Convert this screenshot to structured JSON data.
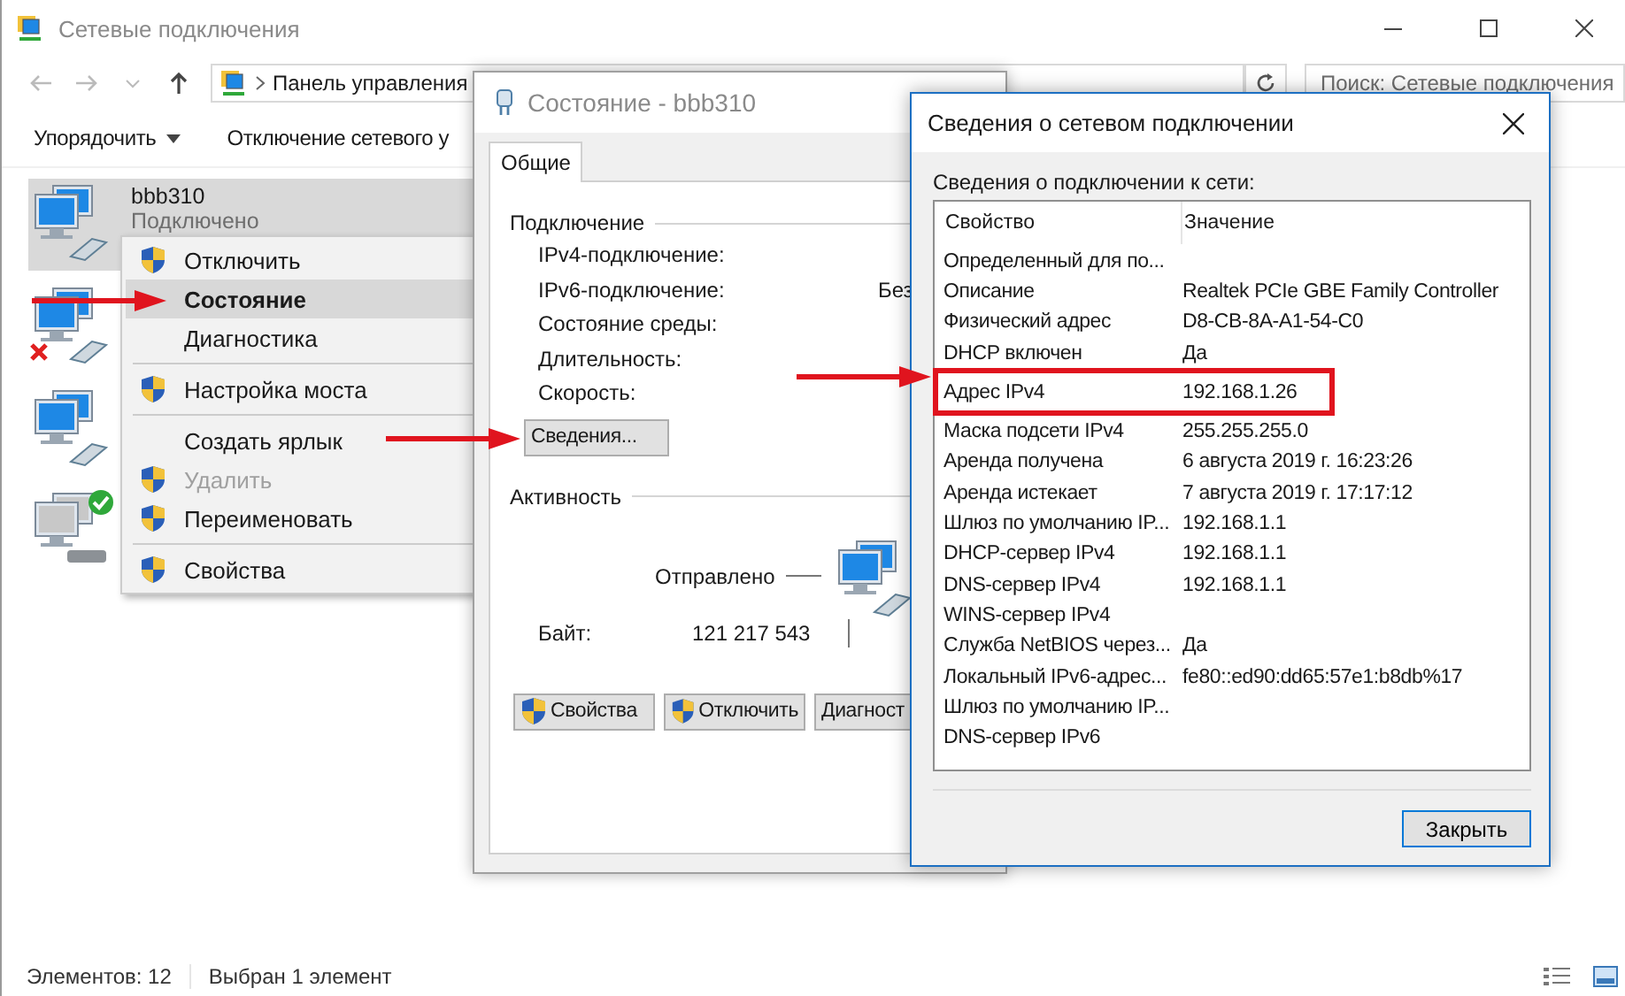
{
  "window": {
    "title": "Сетевые подключения"
  },
  "address_bar": {
    "path": "Панель управления"
  },
  "search": {
    "placeholder": "Поиск: Сетевые подключения"
  },
  "toolbar": [
    {
      "label": "Упорядочить",
      "menu": true
    },
    {
      "label": "Отключение сетевого у",
      "menu": false
    }
  ],
  "connections": [
    {
      "name": "bbb310",
      "status": "Подключено",
      "selected": true,
      "kind": "adapter",
      "error": false,
      "ok": false
    },
    {
      "selected": false,
      "kind": "adapter",
      "error": true,
      "ok": false
    },
    {
      "selected": false,
      "kind": "adapter",
      "error": false,
      "ok": false
    },
    {
      "selected": false,
      "kind": "virtual",
      "error": false,
      "ok": true
    }
  ],
  "context_menu": [
    {
      "kind": "item",
      "label": "Отключить",
      "shield": true,
      "default": false,
      "selected": false,
      "disabled": false
    },
    {
      "kind": "item",
      "label": "Состояние",
      "shield": false,
      "default": true,
      "selected": true,
      "disabled": false
    },
    {
      "kind": "item",
      "label": "Диагностика",
      "shield": false,
      "default": false,
      "selected": false,
      "disabled": false
    },
    {
      "kind": "separator"
    },
    {
      "kind": "item",
      "label": "Настройка моста",
      "shield": true,
      "default": false,
      "selected": false,
      "disabled": false
    },
    {
      "kind": "separator"
    },
    {
      "kind": "item",
      "label": "Создать ярлык",
      "shield": false,
      "default": false,
      "selected": false,
      "disabled": false
    },
    {
      "kind": "item",
      "label": "Удалить",
      "shield": true,
      "default": false,
      "selected": false,
      "disabled": true
    },
    {
      "kind": "item",
      "label": "Переименовать",
      "shield": true,
      "default": false,
      "selected": false,
      "disabled": false
    },
    {
      "kind": "separator"
    },
    {
      "kind": "item",
      "label": "Свойства",
      "shield": true,
      "default": false,
      "selected": false,
      "disabled": false
    }
  ],
  "status_dialog": {
    "title": "Состояние - bbb310",
    "tabs": [
      {
        "label": "Общие",
        "selected": true
      }
    ],
    "connection_group": "Подключение",
    "fields": [
      {
        "label": "IPv4-подключение:"
      },
      {
        "label": "IPv6-подключение:",
        "value": "Без"
      },
      {
        "label": "Состояние среды:"
      },
      {
        "label": "Длительность:"
      },
      {
        "label": "Скорость:"
      }
    ],
    "details_button": "Сведения...",
    "activity_group": "Активность",
    "sent_label": "Отправлено",
    "bytes_label": "Байт:",
    "bytes_sent": "121 217 543",
    "buttons": [
      {
        "label": "Свойства",
        "shield": true
      },
      {
        "label": "Отключить",
        "shield": true
      },
      {
        "label": "Диагност",
        "shield": false
      }
    ]
  },
  "details_dialog": {
    "title": "Сведения о сетевом подключении",
    "caption": "Сведения о подключении к сети:",
    "columns": [
      "Свойство",
      "Значение"
    ],
    "rows": [
      {
        "property": "Определенный для по...",
        "highlighted": false
      },
      {
        "property": "Описание",
        "value": "Realtek PCIe GBE Family Controller",
        "highlighted": false
      },
      {
        "property": "Физический адрес",
        "value": "D8-CB-8A-A1-54-C0",
        "highlighted": false
      },
      {
        "property": "DHCP включен",
        "value": "Да",
        "highlighted": false
      },
      {
        "property": "Адрес IPv4",
        "value": "192.168.1.26",
        "highlighted": true
      },
      {
        "property": "Маска подсети IPv4",
        "value": "255.255.255.0",
        "highlighted": false
      },
      {
        "property": "Аренда получена",
        "value": "6 августа 2019 г. 16:23:26",
        "highlighted": false
      },
      {
        "property": "Аренда истекает",
        "value": "7 августа 2019 г. 17:17:12",
        "highlighted": false
      },
      {
        "property": "Шлюз по умолчанию IP...",
        "value": "192.168.1.1",
        "highlighted": false
      },
      {
        "property": "DHCP-сервер IPv4",
        "value": "192.168.1.1",
        "highlighted": false
      },
      {
        "property": "DNS-сервер IPv4",
        "value": "192.168.1.1",
        "highlighted": false
      },
      {
        "property": "WINS-сервер IPv4",
        "highlighted": false
      },
      {
        "property": "Служба NetBIOS через...",
        "value": "Да",
        "highlighted": false
      },
      {
        "property": "Локальный IPv6-адрес...",
        "value": "fe80::ed90:dd65:57e1:b8db%17",
        "highlighted": false
      },
      {
        "property": "Шлюз по умолчанию IP...",
        "highlighted": false
      },
      {
        "property": "DNS-сервер IPv6",
        "highlighted": false
      }
    ],
    "close_button": "Закрыть"
  },
  "status_bar": [
    "Элементов: 12",
    "Выбран 1 элемент"
  ]
}
